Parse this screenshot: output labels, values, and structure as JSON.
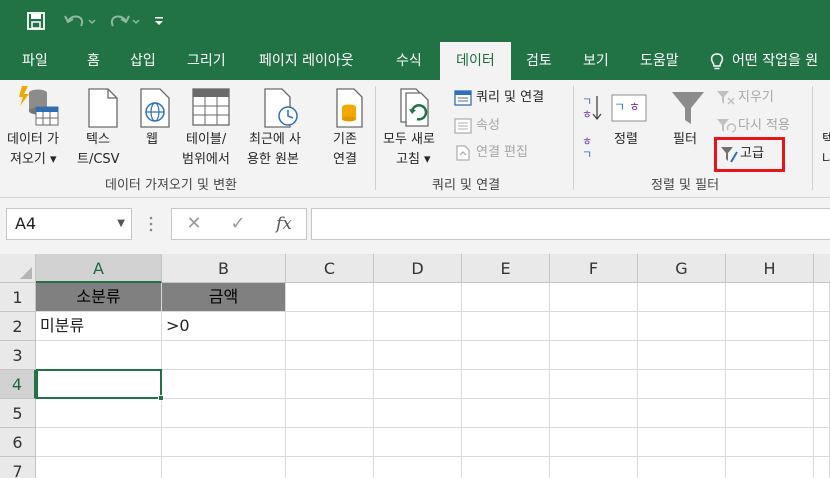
{
  "quick_access": {
    "save_icon": "save-icon",
    "undo_icon": "undo-icon",
    "redo_icon": "redo-icon",
    "customize_icon": "customize-quick-access-icon"
  },
  "tabs": [
    {
      "label": "파일"
    },
    {
      "label": "홈"
    },
    {
      "label": "삽입"
    },
    {
      "label": "그리기"
    },
    {
      "label": "페이지 레이아웃"
    },
    {
      "label": "수식"
    },
    {
      "label": "데이터"
    },
    {
      "label": "검토"
    },
    {
      "label": "보기"
    },
    {
      "label": "도움말"
    },
    {
      "label": "어떤 작업을 원"
    }
  ],
  "ribbon": {
    "get_data": {
      "line1": "데이터 가",
      "line2": "져오기 ▾"
    },
    "text_csv": {
      "line1": "텍스",
      "line2": "트/CSV"
    },
    "web": {
      "line1": "웹"
    },
    "table_range": {
      "line1": "테이블/",
      "line2": "범위에서"
    },
    "recent_sources": {
      "line1": "최근에 사",
      "line2": "용한 원본"
    },
    "existing_connections": {
      "line1": "기존",
      "line2": "연결"
    },
    "refresh_all": {
      "line1": "모두 새로",
      "line2": "고침 ▾"
    },
    "queries_connections": "쿼리 및 연결",
    "properties": "속성",
    "edit_links": "연결 편집",
    "sort": "정렬",
    "filter": "필터",
    "clear": "지우기",
    "reapply": "다시 적용",
    "advanced": "고급",
    "cut_off_line1": "텍",
    "cut_off_line2": "나",
    "groups": {
      "get_transform": "데이터 가져오기 및 변환",
      "queries": "쿼리 및 연결",
      "sort_filter": "정렬 및 필터"
    },
    "sort_az_letters": {
      "top": "ㄱ",
      "bottom": "ㅎ"
    },
    "sort_za_letters": {
      "top": "ㅎ",
      "bottom": "ㄱ"
    },
    "sort_box_letters": {
      "left": "ㄱ",
      "right": "ㅎ"
    }
  },
  "formula_bar": {
    "name_box": "A4",
    "cancel": "✕",
    "enter": "✓",
    "fx": "fx",
    "formula": ""
  },
  "sheet": {
    "columns": [
      "A",
      "B",
      "C",
      "D",
      "E",
      "F",
      "G",
      "H"
    ],
    "rows": [
      "1",
      "2",
      "3",
      "4",
      "5",
      "6",
      "7"
    ],
    "cells": {
      "A1": "소분류",
      "B1": "금액",
      "A2": "미분류",
      "B2": ">0"
    },
    "active_cell": "A4"
  },
  "colors": {
    "brand": "#217346",
    "highlight": "#e8141c",
    "header_fill": "#808080"
  }
}
